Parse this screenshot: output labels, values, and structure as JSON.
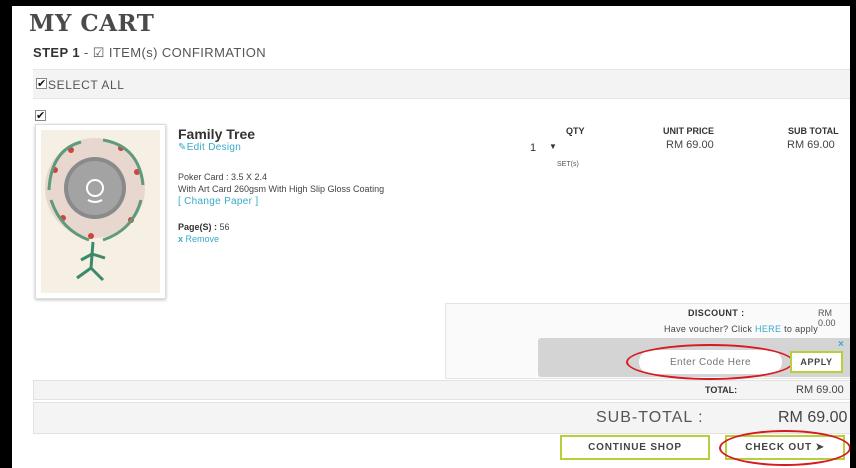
{
  "page": {
    "title": "MY CART",
    "step_label": "STEP 1",
    "step_sep": " - ",
    "step_icon": "checkbox-checked-icon",
    "step_text": "ITEM(s) CONFIRMATION"
  },
  "select_all": {
    "label": "SELECT ALL",
    "checked": true
  },
  "item": {
    "checked": true,
    "name": "Family Tree",
    "edit_link": "Edit Design",
    "spec_line1": "Poker Card : 3.5 X 2.4",
    "spec_line2": "With Art Card 260gsm With High Slip Gloss Coating",
    "change_paper": "[ Change Paper ]",
    "pages_label": "Page(S) :",
    "pages_value": "56",
    "remove_icon": "x",
    "remove_label": "Remove",
    "qty_header": "QTY",
    "qty_value": "1",
    "qty_unit": "SET(s)",
    "unit_price_header": "UNIT PRICE",
    "unit_price": "RM 69.00",
    "sub_total_header": "SUB TOTAL",
    "sub_total": "RM 69.00"
  },
  "discount": {
    "label": "DISCOUNT :",
    "value": "RM 0.00",
    "voucher_prefix": "Have voucher? Click ",
    "voucher_link": "HERE",
    "voucher_suffix": " to apply",
    "close": "×",
    "code_placeholder": "Enter Code Here",
    "apply_label": "APPLY"
  },
  "totals": {
    "total_label": "TOTAL:",
    "total_value": "RM 69.00",
    "subtotal_label": "SUB-TOTAL :",
    "subtotal_value": "RM 69.00"
  },
  "actions": {
    "continue_label": "CONTINUE SHOP",
    "checkout_label": "CHECK OUT ➤"
  },
  "colors": {
    "accent_link": "#39a9c9",
    "button_border": "#b6cf3a",
    "highlight_ring": "#d71920"
  }
}
